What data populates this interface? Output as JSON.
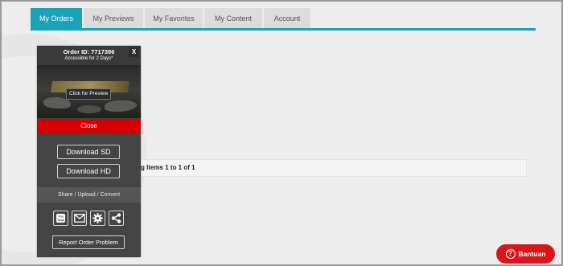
{
  "tabs": [
    {
      "label": "My Orders",
      "active": true
    },
    {
      "label": "My Previews",
      "active": false
    },
    {
      "label": "My Favorites",
      "active": false
    },
    {
      "label": "My Content",
      "active": false
    },
    {
      "label": "Account",
      "active": false
    }
  ],
  "pager": {
    "text": "g Items 1 to 1 of 1"
  },
  "panel": {
    "order_id": "Order ID: 7717396",
    "access": "Accessible for 2 Days*",
    "close_x": "X",
    "preview_button": "Click for Preview",
    "close_label": "Close",
    "download_sd": "Download SD",
    "download_hd": "Download HD",
    "share_label": "Share / Upload / Convert",
    "report_label": "Report Order Problem",
    "youtube_icon_text": "You Tube"
  },
  "help": {
    "label": "Bantuan",
    "icon": "?"
  },
  "colors": {
    "tab_active": "#19a3b8",
    "close_bar": "#d60000",
    "help_button": "#d6171c",
    "panel_bg": "#444444"
  },
  "icons": [
    "youtube-icon",
    "mail-icon",
    "gear-icon",
    "share-icon"
  ]
}
